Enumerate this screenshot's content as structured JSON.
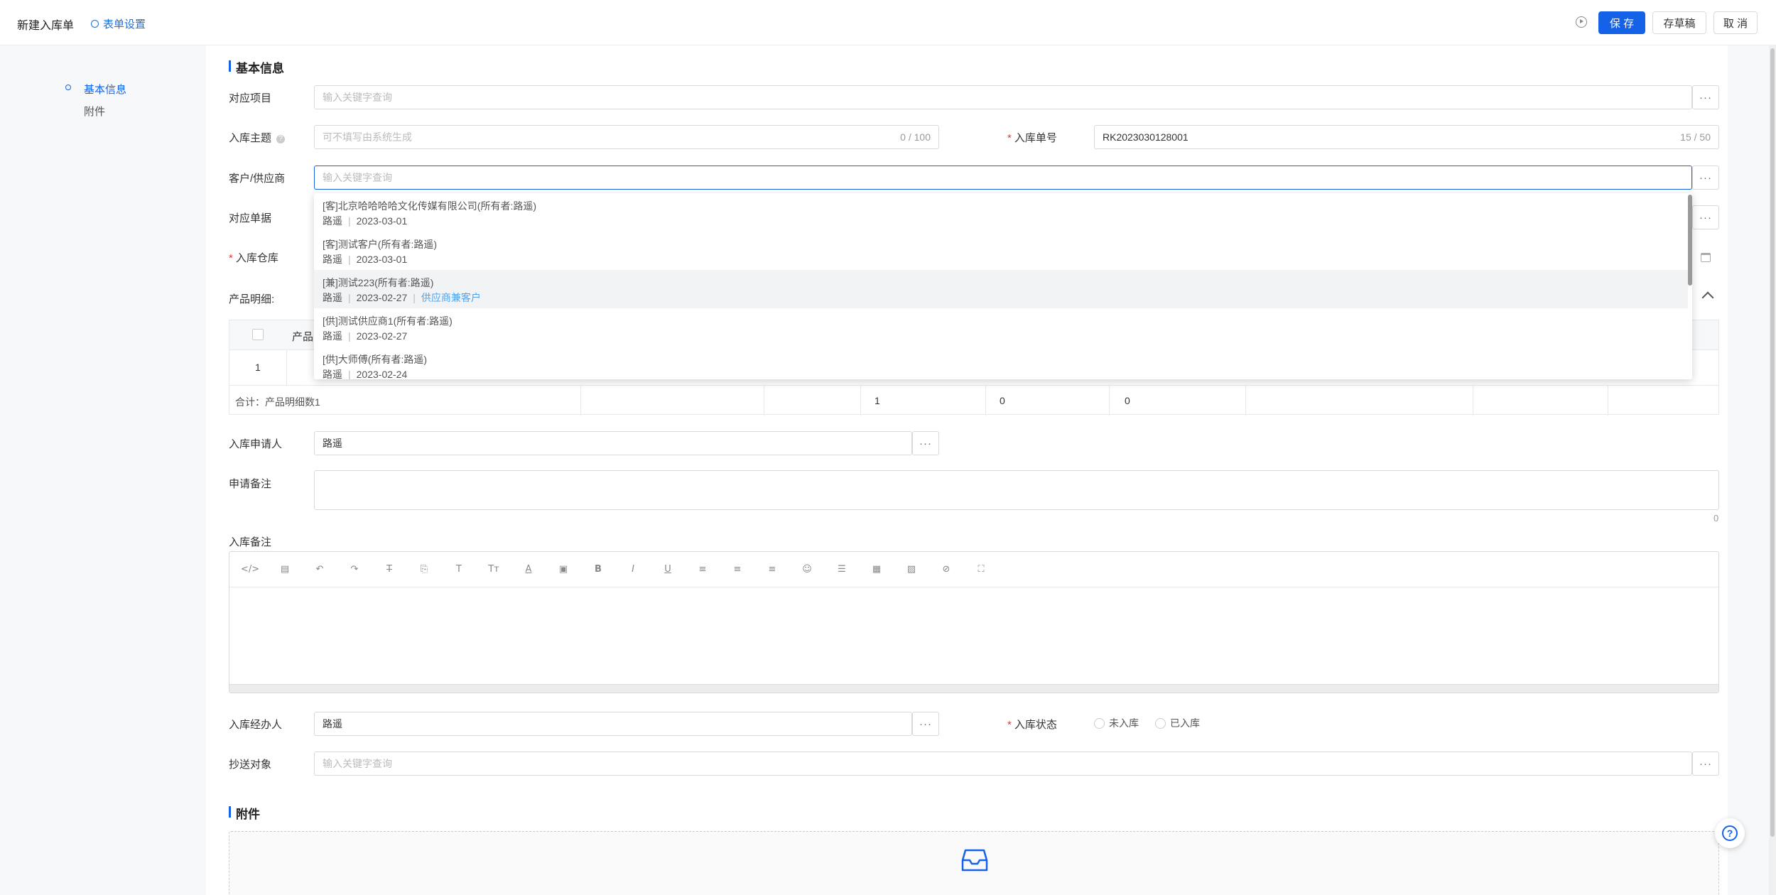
{
  "header": {
    "title": "新建入库单",
    "settings_label": "表单设置",
    "save_label": "保 存",
    "draft_label": "存草稿",
    "cancel_label": "取 消"
  },
  "anchor_nav": [
    {
      "label": "基本信息",
      "active": true
    },
    {
      "label": "附件",
      "active": false
    }
  ],
  "sections": {
    "basic": "基本信息",
    "attachments": "附件"
  },
  "form": {
    "project": {
      "label": "对应项目",
      "placeholder": "输入关键字查询"
    },
    "subject": {
      "label": "入库主题",
      "placeholder": "可不填写由系统生成",
      "count": "0 / 100"
    },
    "order_no": {
      "label": "入库单号",
      "value": "RK2023030128001",
      "count": "15 / 50"
    },
    "customer": {
      "label": "客户/供应商",
      "placeholder": "输入关键字查询"
    },
    "document": {
      "label": "对应单据"
    },
    "warehouse": {
      "label": "入库仓库"
    },
    "products": {
      "label": "产品明细:"
    },
    "applicant": {
      "label": "入库申请人",
      "value": "路遥"
    },
    "apply_note": {
      "label": "申请备注",
      "count": "0"
    },
    "stock_note": {
      "label": "入库备注"
    },
    "handler": {
      "label": "入库经办人",
      "value": "路遥"
    },
    "status": {
      "label": "入库状态",
      "options": [
        "未入库",
        "已入库"
      ]
    },
    "cc": {
      "label": "抄送对象",
      "placeholder": "输入关键字查询"
    }
  },
  "dropdown_options": [
    {
      "title": "[客]北京哈哈哈哈文化传媒有限公司(所有者:路遥)",
      "owner": "路遥",
      "date": "2023-03-01",
      "tag": ""
    },
    {
      "title": "[客]测试客户(所有者:路遥)",
      "owner": "路遥",
      "date": "2023-03-01",
      "tag": ""
    },
    {
      "title": "[兼]测试223(所有者:路遥)",
      "owner": "路遥",
      "date": "2023-02-27",
      "tag": "供应商兼客户",
      "highlighted": true
    },
    {
      "title": "[供]测试供应商1(所有者:路遥)",
      "owner": "路遥",
      "date": "2023-02-27",
      "tag": ""
    },
    {
      "title": "[供]大师傅(所有者:路遥)",
      "owner": "路遥",
      "date": "2023-02-24",
      "tag": ""
    }
  ],
  "product_table": {
    "header_partial": "产品",
    "row_index": "1",
    "summary_label": "合计：产品明细数1",
    "summary_values": [
      "1",
      "0",
      "0"
    ]
  },
  "separator": "|",
  "toolbar_icons": [
    "code-icon",
    "template-icon",
    "undo-icon",
    "redo-icon",
    "strikethrough-icon",
    "format-painter-icon",
    "font-size-icon",
    "clear-format-icon",
    "font-color-icon",
    "background-color-icon",
    "bold-icon",
    "italic-icon",
    "underline-icon",
    "align-left-icon",
    "align-center-icon",
    "align-right-icon",
    "emoji-icon",
    "horizontal-rule-icon",
    "table-icon",
    "image-icon",
    "attachment-icon",
    "fullscreen-icon"
  ],
  "colors": {
    "primary": "#1562e8",
    "required": "#e53935",
    "tag": "#4ea3f0"
  }
}
